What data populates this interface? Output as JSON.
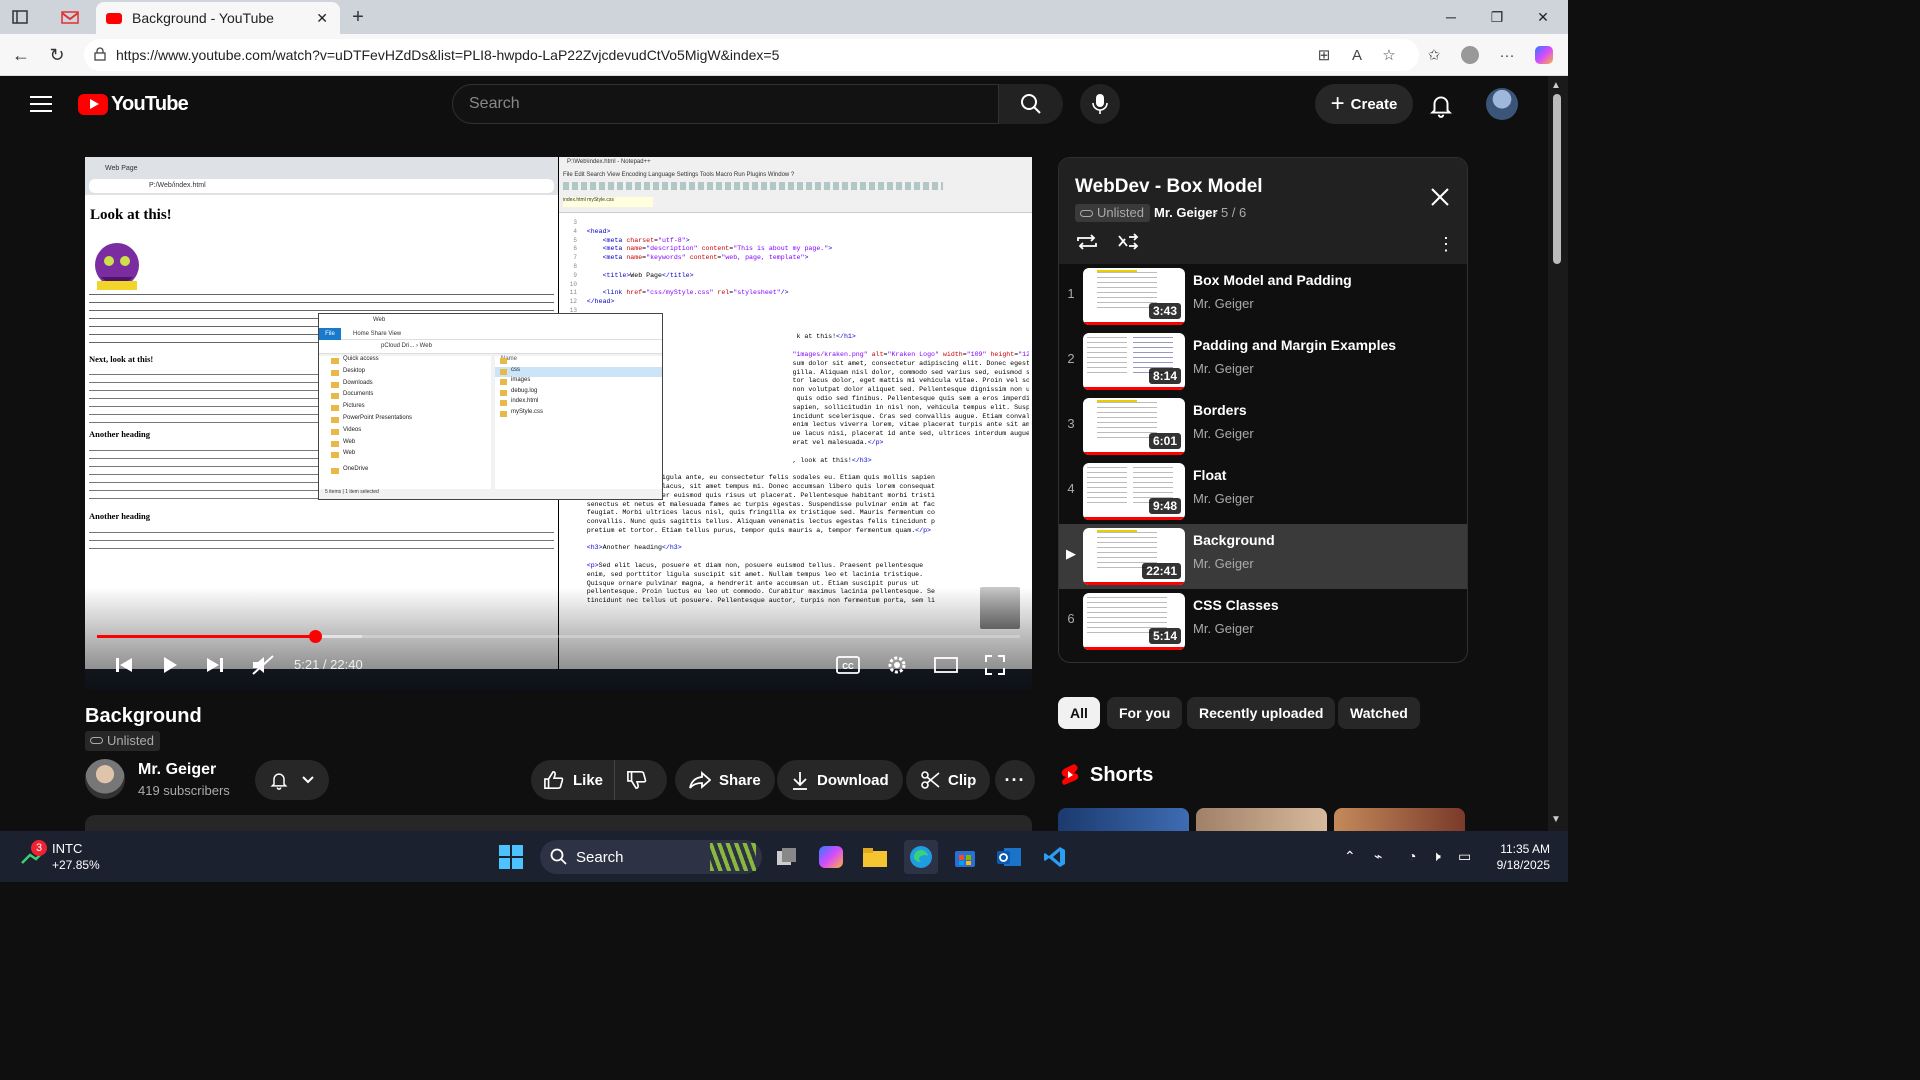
{
  "browser": {
    "tab_title": "Background - YouTube",
    "url": "https://www.youtube.com/watch?v=uDTFevHZdDs&list=PLI8-hwpdo-LaP22ZvjcdevudCtVo5MigW&index=5"
  },
  "header": {
    "logo_text": "YouTube",
    "search_placeholder": "Search",
    "create_label": "Create"
  },
  "video_frame": {
    "page_heading": "Look at this!",
    "browser_tab": "Web Page",
    "browser_address": "P:/Web/index.html",
    "h3_1": "Next, look at this!",
    "h3_2": "Another heading",
    "h3_3": "Another heading",
    "notepad_title": "P:\\Web\\index.html - Notepad++",
    "explorer_title": "Web",
    "explorer_items_side": [
      "Quick access",
      "Desktop",
      "Downloads",
      "Documents",
      "Pictures",
      "PowerPoint Presentations",
      "Videos",
      "Web",
      "Web",
      "OneDrive"
    ],
    "explorer_items_main": [
      "css",
      "images",
      "debug.log",
      "index.html",
      "myStyle.css"
    ],
    "explorer_status": "5 items  |  1 item selected"
  },
  "player": {
    "current_time": "5:21",
    "duration": "22:40",
    "time_display": "5:21 / 22:40",
    "progress": 0.236
  },
  "video": {
    "title": "Background",
    "visibility": "Unlisted",
    "channel": "Mr. Geiger",
    "subscribers": "419 subscribers",
    "like_label": "Like",
    "share_label": "Share",
    "download_label": "Download",
    "clip_label": "Clip"
  },
  "playlist": {
    "title": "WebDev - Box Model",
    "visibility": "Unlisted",
    "owner": "Mr. Geiger",
    "position": "- 5 / 6",
    "items": [
      {
        "index": "1",
        "title": "Box Model and Padding",
        "channel": "Mr. Geiger",
        "duration": "3:43"
      },
      {
        "index": "2",
        "title": "Padding and Margin Examples",
        "channel": "Mr. Geiger",
        "duration": "8:14"
      },
      {
        "index": "3",
        "title": "Borders",
        "channel": "Mr. Geiger",
        "duration": "6:01"
      },
      {
        "index": "4",
        "title": "Float",
        "channel": "Mr. Geiger",
        "duration": "9:48"
      },
      {
        "index": "▶",
        "title": "Background",
        "channel": "Mr. Geiger",
        "duration": "22:41"
      },
      {
        "index": "6",
        "title": "CSS Classes",
        "channel": "Mr. Geiger",
        "duration": "5:14"
      }
    ]
  },
  "chips": [
    "All",
    "For you",
    "Recently uploaded",
    "Watched"
  ],
  "shorts_label": "Shorts",
  "taskbar": {
    "stock_ticker": "INTC",
    "stock_change": "+27.85%",
    "notification_count": "3",
    "search_label": "Search",
    "time": "11:35 AM",
    "date": "9/18/2025"
  },
  "colors": {
    "brand_red": "#ff0000",
    "background": "#0f0f0f",
    "surface": "#272727"
  }
}
